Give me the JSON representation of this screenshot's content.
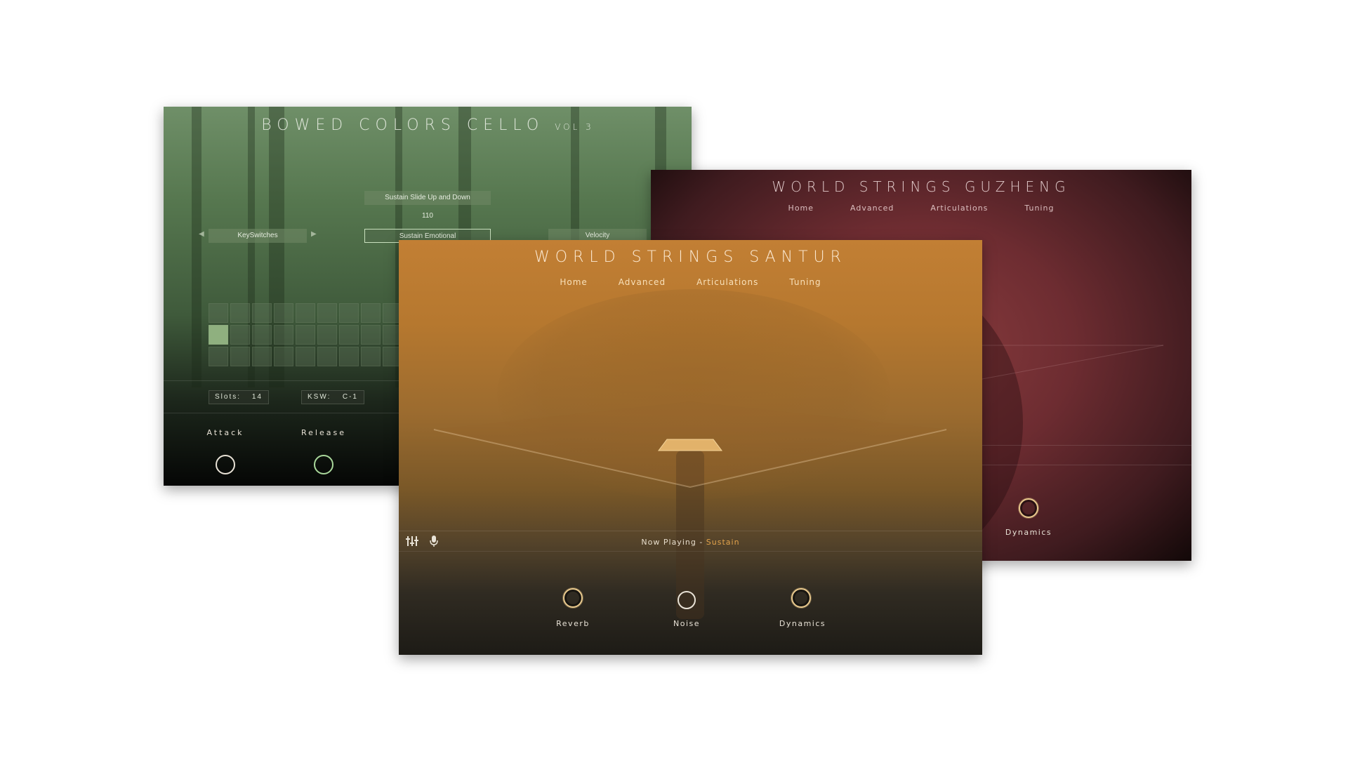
{
  "cello": {
    "title": "BOWED COLORS CELLO",
    "title_suffix": "VOL 3",
    "articulation_top": "Sustain Slide Up and Down",
    "articulation_value": "110",
    "keyswitches_label": "KeySwitches",
    "articulation_selected": "Sustain Emotional",
    "velocity_label": "Velocity",
    "slots_label": "Slots:",
    "slots_value": "14",
    "ksw_label": "KSW:",
    "ksw_value": "C-1",
    "attack_label": "Attack",
    "release_label": "Release"
  },
  "guzheng": {
    "title": "WORLD STRINGS GUZHENG",
    "nav": [
      "Home",
      "Advanced",
      "Articulations",
      "Tuning"
    ],
    "dynamics_label": "Dynamics"
  },
  "santur": {
    "title": "WORLD STRINGS SANTUR",
    "nav": [
      "Home",
      "Advanced",
      "Articulations",
      "Tuning"
    ],
    "now_playing_label": "Now Playing -",
    "now_playing_value": "Sustain",
    "knobs": [
      "Reverb",
      "Noise",
      "Dynamics"
    ]
  },
  "icons": [
    "mixer-icon",
    "microphone-icon"
  ],
  "colors": {
    "santur_accent": "#e3a34c",
    "cello_active": "#8fb07f",
    "knob_gold": "#e9c98d"
  }
}
